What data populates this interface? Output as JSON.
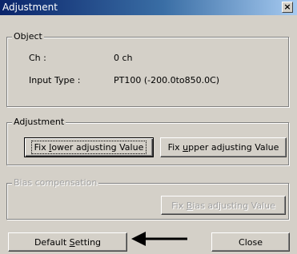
{
  "window": {
    "title": "Adjustment",
    "close_glyph": "×"
  },
  "object_group": {
    "legend": "Object",
    "rows": [
      {
        "label": "Ch :",
        "value": "0 ch"
      },
      {
        "label": "Input Type :",
        "value": "PT100 (-200.0to850.0C)"
      }
    ]
  },
  "adjustment_group": {
    "legend": "Adjustment",
    "lower_button": {
      "pre": "Fix ",
      "mnemonic": "l",
      "post": "ower adjusting Value"
    },
    "upper_button": {
      "pre": "Fix ",
      "mnemonic": "u",
      "post": "pper adjusting Value"
    }
  },
  "bias_group": {
    "legend": "Bias compensation",
    "enabled": false,
    "bias_button": {
      "pre": "Fix ",
      "mnemonic": "B",
      "post": "ias adjusting Value"
    }
  },
  "footer": {
    "default_button": {
      "pre": "Default ",
      "mnemonic": "S",
      "post": "etting"
    },
    "close_button": "Close"
  },
  "annotation": {
    "arrow_color": "#000000"
  }
}
